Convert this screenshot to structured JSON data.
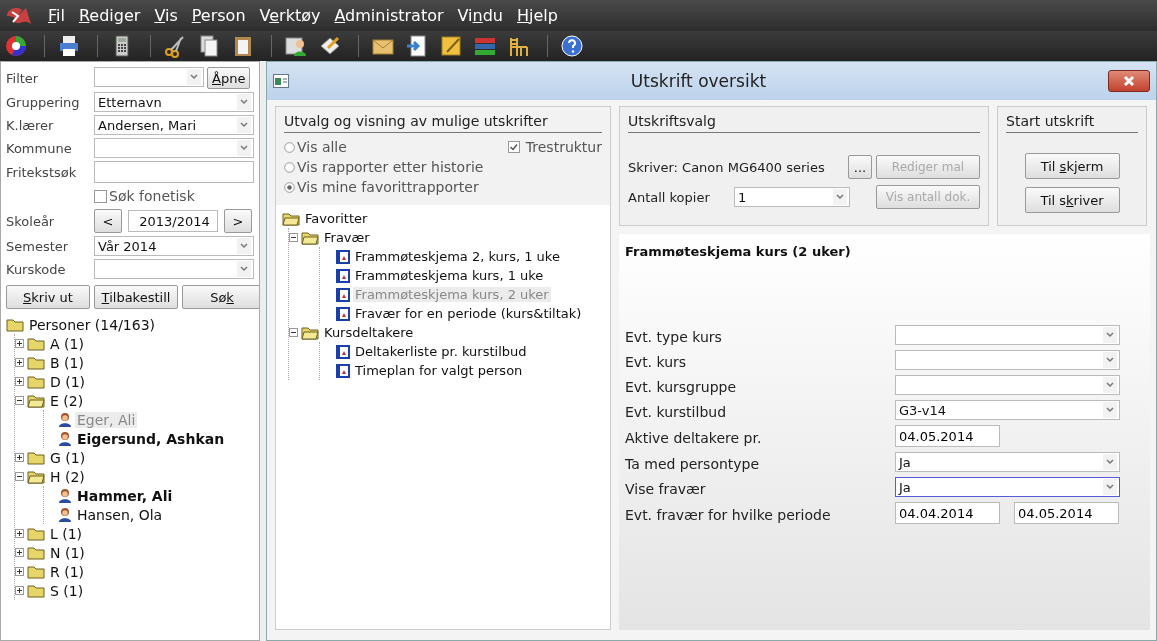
{
  "menu": [
    {
      "key": "F",
      "post": "il"
    },
    {
      "key": "R",
      "post": "ediger"
    },
    {
      "key": "V",
      "post": "is"
    },
    {
      "key": "P",
      "post": "erson"
    },
    {
      "pre": "V",
      "key": "e",
      "post": "rktøy"
    },
    {
      "key": "A",
      "post": "dministrator"
    },
    {
      "pre": "Vi",
      "key": "n",
      "post": "du"
    },
    {
      "key": "H",
      "post": "jelp"
    }
  ],
  "left_panel": {
    "fields": [
      {
        "kind": "select_button",
        "label": "Filter",
        "button": {
          "key": "Å",
          "post": "pne"
        }
      },
      {
        "kind": "select",
        "label": "Gruppering",
        "value": "Etternavn"
      },
      {
        "kind": "select",
        "label": "K.lærer",
        "value": "Andersen, Mari"
      },
      {
        "kind": "select",
        "label": "Kommune"
      },
      {
        "kind": "text",
        "label": "Fritekstsøk"
      },
      {
        "kind": "checkbox",
        "label": "Søk fonetisk",
        "checked": false
      },
      {
        "kind": "stepper",
        "label": "Skoleår",
        "value": "2013/2014",
        "prev": "<",
        "next": ">"
      },
      {
        "kind": "select",
        "label": "Semester",
        "value": "Vår 2014"
      },
      {
        "kind": "select",
        "label": "Kurskode"
      }
    ],
    "buttons": [
      {
        "key": "S",
        "post": "kriv ut"
      },
      {
        "key": "T",
        "post": "ilbakestill"
      },
      {
        "pre": "Sø",
        "key": "k"
      }
    ],
    "tree": {
      "label": "Personer (14/163)",
      "children": [
        {
          "label": "A  (1)",
          "expanded": false
        },
        {
          "label": "B  (1)",
          "expanded": false
        },
        {
          "label": "D  (1)",
          "expanded": false
        },
        {
          "label": "E  (2)",
          "expanded": true,
          "children": [
            {
              "label": "Eger, Ali",
              "bold": false,
              "selected": true
            },
            {
              "label": "Eigersund, Ashkan",
              "bold": true,
              "selected": false
            }
          ]
        },
        {
          "label": "G  (1)",
          "expanded": false
        },
        {
          "label": "H  (2)",
          "expanded": true,
          "children": [
            {
              "label": "Hammer, Ali",
              "bold": true,
              "selected": false
            },
            {
              "label": "Hansen, Ola",
              "bold": false,
              "selected": false
            }
          ]
        },
        {
          "label": "L  (1)",
          "expanded": false
        },
        {
          "label": "N  (1)",
          "expanded": false
        },
        {
          "label": "R  (1)",
          "expanded": false
        },
        {
          "label": "S  (1)",
          "expanded": false
        }
      ]
    }
  },
  "dialog": {
    "title": "Utskrift oversikt",
    "selection": {
      "heading": "Utvalg og visning av mulige utskrifter",
      "radios": [
        {
          "label": "Vis alle",
          "selected": false
        },
        {
          "label": "Vis rapporter etter historie",
          "selected": false
        },
        {
          "label": "Vis mine favorittrapporter",
          "selected": true
        }
      ],
      "tree_option": {
        "label": "Trestruktur",
        "checked": true
      },
      "tree": {
        "label": "Favoritter",
        "children": [
          {
            "label": "Fravær",
            "expanded": true,
            "children": [
              {
                "label": "Frammøteskjema 2, kurs, 1 uke",
                "selected": false
              },
              {
                "label": "Frammøteskjema kurs, 1 uke",
                "selected": false
              },
              {
                "label": "Frammøteskjema kurs, 2 uker",
                "selected": true
              },
              {
                "label": "Fravær for en periode (kurs&tiltak)",
                "selected": false
              }
            ]
          },
          {
            "label": "Kursdeltakere",
            "expanded": true,
            "children": [
              {
                "label": "Deltakerliste pr. kurstilbud",
                "selected": false
              },
              {
                "label": "Timeplan for valgt person",
                "selected": false
              }
            ]
          }
        ]
      }
    },
    "print_options": {
      "heading": "Utskriftsvalg",
      "printer": "Skriver: Canon MG6400 series",
      "browse": "...",
      "edit_template": {
        "label": "Rediger mal",
        "disabled": true
      },
      "copies_label": "Antall kopier",
      "copies": "1",
      "show_count": {
        "label": "Vis antall dok.",
        "disabled": true
      }
    },
    "start": {
      "heading": "Start utskrift",
      "buttons": [
        {
          "pre": "Til ",
          "key": "s",
          "post": "kjerm"
        },
        {
          "pre": "Til s",
          "key": "k",
          "post": "river"
        }
      ]
    },
    "report_title": "Frammøteskjema kurs (2 uker)",
    "params": [
      {
        "kind": "select",
        "label": "Evt. type kurs",
        "focused": false
      },
      {
        "kind": "select",
        "label": "Evt. kurs",
        "focused": false
      },
      {
        "kind": "select",
        "label": "Evt. kursgruppe",
        "focused": false
      },
      {
        "kind": "select",
        "label": "Evt. kurstilbud",
        "value": "G3-v14",
        "focused": false
      },
      {
        "kind": "date",
        "label": "Aktive deltakere pr.",
        "value": "04.05.2014",
        "focused": false
      },
      {
        "kind": "select",
        "label": "Ta med persontype",
        "value": "Ja",
        "focused": false
      },
      {
        "kind": "select",
        "label": "Vise fravær",
        "value": "Ja",
        "focused": true
      },
      {
        "kind": "daterange",
        "label": "Evt. fravær for hvilke periode",
        "from": "04.04.2014",
        "to": "04.05.2014",
        "focused": false
      }
    ]
  }
}
